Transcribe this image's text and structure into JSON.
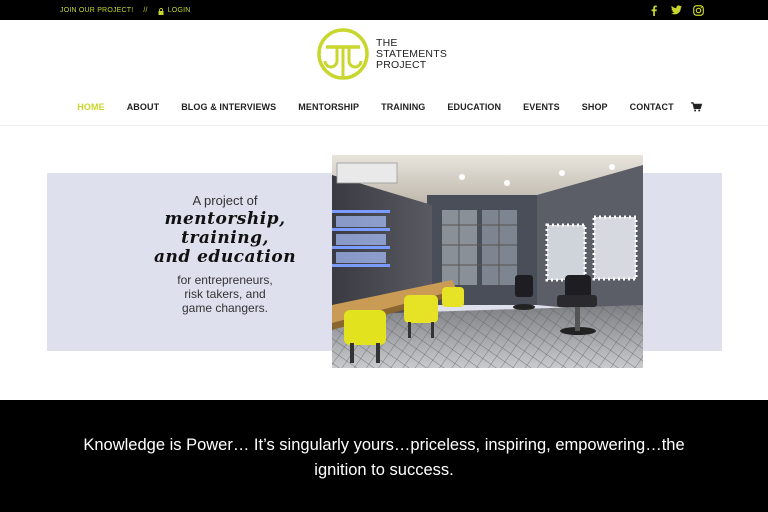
{
  "topbar": {
    "join_label": "JOIN OUR PROJECT!",
    "separator": "//",
    "login_label": "LOGIN",
    "social": [
      "facebook-icon",
      "twitter-icon",
      "instagram-icon"
    ]
  },
  "brand": {
    "line1": "THE",
    "line2": "STATEMENTS",
    "line3": "PROJECT",
    "accent": "#c8d62e"
  },
  "nav": {
    "items": [
      "HOME",
      "ABOUT",
      "BLOG & INTERVIEWS",
      "MENTORSHIP",
      "TRAINING",
      "EDUCATION",
      "EVENTS",
      "SHOP",
      "CONTACT"
    ],
    "active": "HOME",
    "cart_icon": "cart-icon"
  },
  "hero": {
    "intro": "A project of",
    "script_line1": "mentorship,",
    "script_line2": "training,",
    "script_line3": "and education",
    "sub_line1": "for entrepreneurs,",
    "sub_line2": "risk takers, and",
    "sub_line3": "game changers.",
    "panel_color": "#dfe0ee"
  },
  "quote": {
    "text": "Knowledge is Power… It’s singularly yours…priceless, inspiring, empowering…the ignition to success."
  }
}
